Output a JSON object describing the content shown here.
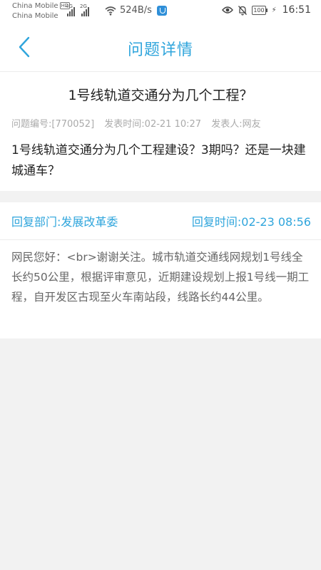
{
  "status_bar": {
    "carrier_1": "China Mobile",
    "carrier_1_badge": "HD",
    "carrier_2": "China Mobile",
    "signal_1_tag": "4G",
    "signal_2_tag": "2G",
    "net_speed": "524B/s",
    "battery": "100",
    "time": "16:51"
  },
  "header": {
    "title": "问题详情"
  },
  "question": {
    "title": "1号线轨道交通分为几个工程？",
    "meta_id": "问题编号:[770052]",
    "meta_time": "发表时间:02-21 10:27",
    "meta_author": "发表人:网友",
    "body": "1号线轨道交通分为几个工程建设？3期吗？还是一块建城通车？"
  },
  "reply": {
    "department": "回复部门:发展改革委",
    "time": "回复时间:02-23 08:56",
    "body": "网民您好：<br>谢谢关注。城市轨道交通线网规划1号线全长约50公里，根据评审意见，近期建设规划上报1号线一期工程，自开发区古现至火车南站段，线路长约44公里。"
  },
  "colors": {
    "accent": "#2fa5dc",
    "background": "#f2f2f2",
    "meta_gray": "#aaaaaa"
  }
}
